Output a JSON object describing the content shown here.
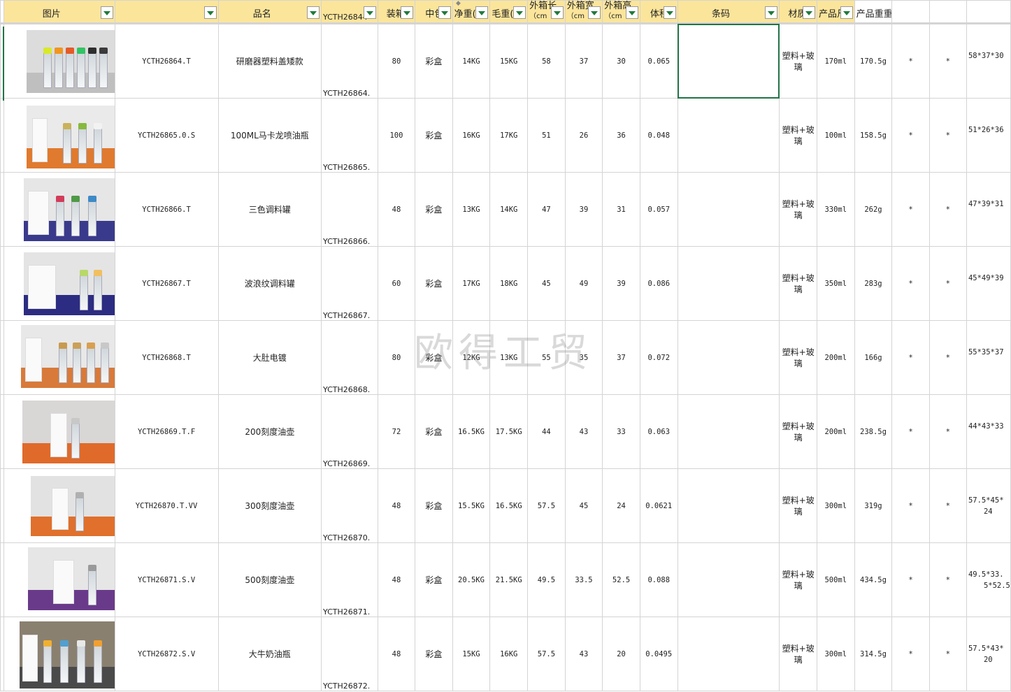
{
  "headers": [
    {
      "label": "图片",
      "filter": true
    },
    {
      "label": "",
      "filter": true
    },
    {
      "label": "品名",
      "filter": true
    },
    {
      "label": "YCTH26844",
      "filter": true
    },
    {
      "label": "装箱",
      "filter": true
    },
    {
      "label": "中包",
      "filter": true
    },
    {
      "label": "净重(",
      "filter": true
    },
    {
      "label": "毛重(",
      "filter": true
    },
    {
      "label": "外箱长",
      "sub": "（cm",
      "filter": true
    },
    {
      "label": "外箱宽",
      "sub": "（cm",
      "filter": true
    },
    {
      "label": "外箱高",
      "sub": "（cm",
      "filter": true
    },
    {
      "label": "体积",
      "filter": true
    },
    {
      "label": "条码",
      "filter": true
    },
    {
      "label": "材质",
      "filter": true
    },
    {
      "label": "产品尺",
      "filter": true
    },
    {
      "label": "产品重重",
      "filter": false
    },
    {
      "label": "",
      "filter": false
    },
    {
      "label": "",
      "filter": false
    },
    {
      "label": "",
      "filter": false
    }
  ],
  "rows": [
    {
      "code": "YCTH26864.T",
      "name": "研磨器塑料盖矮款",
      "ycode": "YCTH26864.",
      "qty": "80",
      "pack": "彩盒",
      "net": "14KG",
      "gross": "15KG",
      "len": "58",
      "wid": "37",
      "hei": "30",
      "vol": "0.065",
      "barcode": "",
      "mat1": "塑料+玻",
      "mat2": "璃",
      "size": "170ml",
      "weight": "170.5g",
      "c1": "*",
      "c2": "*",
      "dims1": "58*37*30",
      "dims2": ""
    },
    {
      "code": "YCTH26865.0.S",
      "name": "100ML马卡龙喷油瓶",
      "ycode": "YCTH26865.",
      "qty": "100",
      "pack": "彩盒",
      "net": "16KG",
      "gross": "17KG",
      "len": "51",
      "wid": "26",
      "hei": "36",
      "vol": "0.048",
      "barcode": "",
      "mat1": "塑料+玻",
      "mat2": "璃",
      "size": "100ml",
      "weight": "158.5g",
      "c1": "*",
      "c2": "*",
      "dims1": "51*26*36",
      "dims2": ""
    },
    {
      "code": "YCTH26866.T",
      "name": "三色调料罐",
      "ycode": "YCTH26866.",
      "qty": "48",
      "pack": "彩盒",
      "net": "13KG",
      "gross": "14KG",
      "len": "47",
      "wid": "39",
      "hei": "31",
      "vol": "0.057",
      "barcode": "",
      "mat1": "塑料+玻",
      "mat2": "璃",
      "size": "330ml",
      "weight": "262g",
      "c1": "*",
      "c2": "*",
      "dims1": "47*39*31",
      "dims2": ""
    },
    {
      "code": "YCTH26867.T",
      "name": "波浪纹调料罐",
      "ycode": "YCTH26867.",
      "qty": "60",
      "pack": "彩盒",
      "net": "17KG",
      "gross": "18KG",
      "len": "45",
      "wid": "49",
      "hei": "39",
      "vol": "0.086",
      "barcode": "",
      "mat1": "塑料+玻",
      "mat2": "璃",
      "size": "350ml",
      "weight": "283g",
      "c1": "*",
      "c2": "*",
      "dims1": "45*49*39",
      "dims2": ""
    },
    {
      "code": "YCTH26868.T",
      "name": "大肚电镀",
      "ycode": "YCTH26868.",
      "qty": "80",
      "pack": "彩盒",
      "net": "12KG",
      "gross": "13KG",
      "len": "55",
      "wid": "35",
      "hei": "37",
      "vol": "0.072",
      "barcode": "",
      "mat1": "塑料+玻",
      "mat2": "璃",
      "size": "200ml",
      "weight": "166g",
      "c1": "*",
      "c2": "*",
      "dims1": "55*35*37",
      "dims2": ""
    },
    {
      "code": "YCTH26869.T.F",
      "name": "200刻度油壶",
      "ycode": "YCTH26869.",
      "qty": "72",
      "pack": "彩盒",
      "net": "16.5KG",
      "gross": "17.5KG",
      "len": "44",
      "wid": "43",
      "hei": "33",
      "vol": "0.063",
      "barcode": "",
      "mat1": "塑料+玻",
      "mat2": "璃",
      "size": "200ml",
      "weight": "238.5g",
      "c1": "*",
      "c2": "*",
      "dims1": "44*43*33",
      "dims2": ""
    },
    {
      "code": "YCTH26870.T.VV",
      "name": "300刻度油壶",
      "ycode": "YCTH26870.",
      "qty": "48",
      "pack": "彩盒",
      "net": "15.5KG",
      "gross": "16.5KG",
      "len": "57.5",
      "wid": "45",
      "hei": "24",
      "vol": "0.0621",
      "barcode": "",
      "mat1": "塑料+玻",
      "mat2": "璃",
      "size": "300ml",
      "weight": "319g",
      "c1": "*",
      "c2": "*",
      "dims1": "57.5*45*",
      "dims2": "24"
    },
    {
      "code": "YCTH26871.S.V",
      "name": "500刻度油壶",
      "ycode": "YCTH26871.",
      "qty": "48",
      "pack": "彩盒",
      "net": "20.5KG",
      "gross": "21.5KG",
      "len": "49.5",
      "wid": "33.5",
      "hei": "52.5",
      "vol": "0.088",
      "barcode": "",
      "mat1": "塑料+玻",
      "mat2": "璃",
      "size": "500ml",
      "weight": "434.5g",
      "c1": "*",
      "c2": "*",
      "dims1": "49.5*33.",
      "dims2": "5*52.5"
    },
    {
      "code": "YCTH26872.S.V",
      "name": "大牛奶油瓶",
      "ycode": "YCTH26872.",
      "qty": "48",
      "pack": "彩盒",
      "net": "15KG",
      "gross": "16KG",
      "len": "57.5",
      "wid": "43",
      "hei": "20",
      "vol": "0.0495",
      "barcode": "",
      "mat1": "塑料+玻",
      "mat2": "璃",
      "size": "300ml",
      "weight": "314.5g",
      "c1": "*",
      "c2": "*",
      "dims1": "57.5*43*",
      "dims2": "20"
    }
  ],
  "watermark": "欧得工贸",
  "colors": {
    "header_bg": "#fbe59b",
    "selection": "#217346",
    "filter_arrow": "#1f7a3a",
    "grid": "#d4d4d4"
  }
}
